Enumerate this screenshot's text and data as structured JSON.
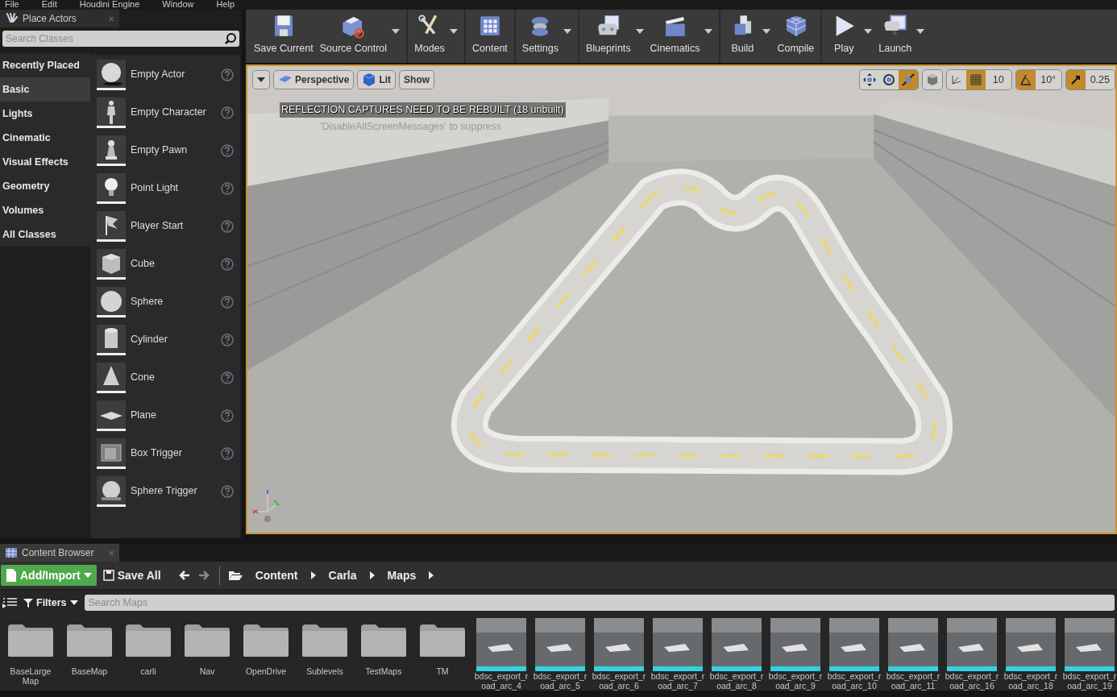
{
  "menu": [
    "File",
    "Edit",
    "Houdini Engine",
    "Window",
    "Help"
  ],
  "place_actors": {
    "tab": "Place Actors",
    "close": "×",
    "search": {
      "placeholder": "Search Classes"
    },
    "categories": [
      {
        "label": "Recently Placed",
        "selected": false
      },
      {
        "label": "Basic",
        "selected": true
      },
      {
        "label": "Lights",
        "selected": false
      },
      {
        "label": "Cinematic",
        "selected": false
      },
      {
        "label": "Visual Effects",
        "selected": false
      },
      {
        "label": "Geometry",
        "selected": false
      },
      {
        "label": "Volumes",
        "selected": false
      },
      {
        "label": "All Classes",
        "selected": false
      }
    ],
    "items": [
      "Empty Actor",
      "Empty Character",
      "Empty Pawn",
      "Point Light",
      "Player Start",
      "Cube",
      "Sphere",
      "Cylinder",
      "Cone",
      "Plane",
      "Box Trigger",
      "Sphere Trigger"
    ]
  },
  "toolbar": {
    "groups": [
      [
        {
          "label": "Save Current",
          "dropdown": false
        },
        {
          "label": "Source Control",
          "dropdown": true
        }
      ],
      [
        {
          "label": "Modes",
          "dropdown": true
        }
      ],
      [
        {
          "label": "Content",
          "dropdown": false
        }
      ],
      [
        {
          "label": "Settings",
          "dropdown": true
        }
      ],
      [
        {
          "label": "Blueprints",
          "dropdown": true
        },
        {
          "label": "Cinematics",
          "dropdown": true
        }
      ],
      [
        {
          "label": "Build",
          "dropdown": true
        },
        {
          "label": "Compile",
          "dropdown": false
        }
      ],
      [
        {
          "label": "Play",
          "dropdown": true
        },
        {
          "label": "Launch",
          "dropdown": true
        }
      ]
    ]
  },
  "viewport": {
    "view_buttons": [
      "Perspective",
      "Lit",
      "Show"
    ],
    "messages": [
      {
        "text": "REFLECTION CAPTURES NEED TO BE REBUILT (18 unbuilt)",
        "kind": "warning"
      },
      {
        "text": "'DisableAllScreenMessages' to suppress",
        "kind": "hint"
      }
    ],
    "transform_tools": [
      {
        "selected": false
      },
      {
        "selected": false
      },
      {
        "selected": true
      }
    ],
    "surface_snapping": {
      "on": false
    },
    "grid_snap": {
      "on": true,
      "value": "10"
    },
    "rotation_snap": {
      "on": true,
      "value": "10°"
    },
    "scale_snap": {
      "on": true,
      "value": "0.25"
    }
  },
  "content_browser": {
    "tab": "Content Browser",
    "close": "×",
    "add_import": "Add/Import",
    "save_all": "Save All",
    "path": [
      "Content",
      "Carla",
      "Maps"
    ],
    "filters": "Filters",
    "search": {
      "placeholder": "Search Maps"
    },
    "assets": [
      {
        "kind": "folder",
        "name": "BaseLarge Map"
      },
      {
        "kind": "folder",
        "name": "BaseMap"
      },
      {
        "kind": "folder",
        "name": "carli"
      },
      {
        "kind": "folder",
        "name": "Nav"
      },
      {
        "kind": "folder",
        "name": "OpenDrive"
      },
      {
        "kind": "folder",
        "name": "Sublevels"
      },
      {
        "kind": "folder",
        "name": "TestMaps"
      },
      {
        "kind": "folder",
        "name": "TM"
      },
      {
        "kind": "map",
        "name": "bdsc_export_road_arc_4"
      },
      {
        "kind": "map",
        "name": "bdsc_export_road_arc_5"
      },
      {
        "kind": "map",
        "name": "bdsc_export_road_arc_6"
      },
      {
        "kind": "map",
        "name": "bdsc_export_road_arc_7"
      },
      {
        "kind": "map",
        "name": "bdsc_export_road_arc_8"
      },
      {
        "kind": "map",
        "name": "bdsc_export_road_arc_9"
      },
      {
        "kind": "map",
        "name": "bdsc_export_road_arc_10"
      },
      {
        "kind": "map",
        "name": "bdsc_export_road_arc_11"
      },
      {
        "kind": "map",
        "name": "bdsc_export_road_arc_16"
      },
      {
        "kind": "map",
        "name": "bdsc_export_road_arc_18"
      },
      {
        "kind": "map",
        "name": "bdsc_export_road_arc_19"
      }
    ]
  }
}
